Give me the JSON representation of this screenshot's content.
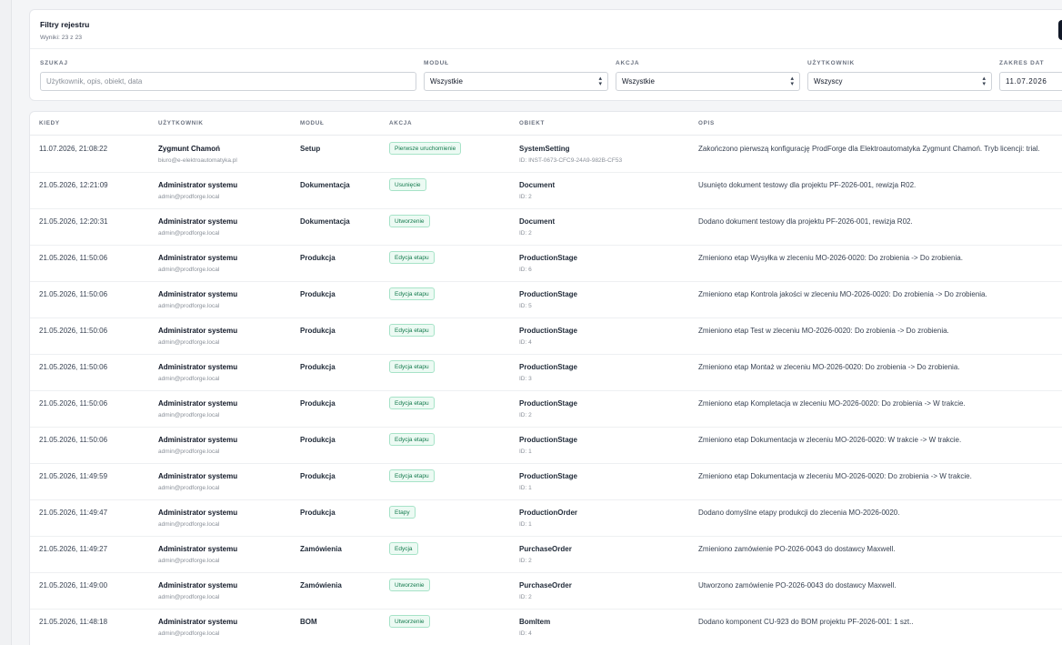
{
  "filters": {
    "title": "Filtry rejestru",
    "results": "Wyniki: 23 z 23",
    "search_label": "SZUKAJ",
    "search_placeholder": "Użytkownik, opis, obiekt, data",
    "module_label": "MODUŁ",
    "module_value": "Wszystkie",
    "action_label": "AKCJA",
    "action_value": "Wszystkie",
    "user_label": "UŻYTKOWNIK",
    "user_value": "Wszyscy",
    "date_label": "ZAKRES DAT",
    "date_value": "11.07.2026"
  },
  "table": {
    "headers": {
      "when": "KIEDY",
      "user": "UŻYTKOWNIK",
      "module": "MODUŁ",
      "action": "AKCJA",
      "object": "OBIEKT",
      "description": "OPIS"
    },
    "rows": [
      {
        "when": "11.07.2026, 21:08:22",
        "user": "Zygmunt Chamoń",
        "email": "biuro@e-elektroautomatyka.pl",
        "module": "Setup",
        "action": "Pierwsze uruchomienie",
        "object": "SystemSetting",
        "object_id": "ID: INST-0673-CFC9-24A9-982B-CF53",
        "description": "Zakończono pierwszą konfigurację ProdForge dla Elektroautomatyka Zygmunt Chamoń. Tryb licencji: trial."
      },
      {
        "when": "21.05.2026, 12:21:09",
        "user": "Administrator systemu",
        "email": "admin@prodforge.local",
        "module": "Dokumentacja",
        "action": "Usunięcie",
        "object": "Document",
        "object_id": "ID: 2",
        "description": "Usunięto dokument testowy dla projektu PF-2026-001, rewizja R02."
      },
      {
        "when": "21.05.2026, 12:20:31",
        "user": "Administrator systemu",
        "email": "admin@prodforge.local",
        "module": "Dokumentacja",
        "action": "Utworzenie",
        "object": "Document",
        "object_id": "ID: 2",
        "description": "Dodano dokument testowy dla projektu PF-2026-001, rewizja R02."
      },
      {
        "when": "21.05.2026, 11:50:06",
        "user": "Administrator systemu",
        "email": "admin@prodforge.local",
        "module": "Produkcja",
        "action": "Edycja etapu",
        "object": "ProductionStage",
        "object_id": "ID: 6",
        "description": "Zmieniono etap Wysyłka w zleceniu MO-2026-0020: Do zrobienia -> Do zrobienia."
      },
      {
        "when": "21.05.2026, 11:50:06",
        "user": "Administrator systemu",
        "email": "admin@prodforge.local",
        "module": "Produkcja",
        "action": "Edycja etapu",
        "object": "ProductionStage",
        "object_id": "ID: 5",
        "description": "Zmieniono etap Kontrola jakości w zleceniu MO-2026-0020: Do zrobienia -> Do zrobienia."
      },
      {
        "when": "21.05.2026, 11:50:06",
        "user": "Administrator systemu",
        "email": "admin@prodforge.local",
        "module": "Produkcja",
        "action": "Edycja etapu",
        "object": "ProductionStage",
        "object_id": "ID: 4",
        "description": "Zmieniono etap Test w zleceniu MO-2026-0020: Do zrobienia -> Do zrobienia."
      },
      {
        "when": "21.05.2026, 11:50:06",
        "user": "Administrator systemu",
        "email": "admin@prodforge.local",
        "module": "Produkcja",
        "action": "Edycja etapu",
        "object": "ProductionStage",
        "object_id": "ID: 3",
        "description": "Zmieniono etap Montaż w zleceniu MO-2026-0020: Do zrobienia -> Do zrobienia."
      },
      {
        "when": "21.05.2026, 11:50:06",
        "user": "Administrator systemu",
        "email": "admin@prodforge.local",
        "module": "Produkcja",
        "action": "Edycja etapu",
        "object": "ProductionStage",
        "object_id": "ID: 2",
        "description": "Zmieniono etap Kompletacja w zleceniu MO-2026-0020: Do zrobienia -> W trakcie."
      },
      {
        "when": "21.05.2026, 11:50:06",
        "user": "Administrator systemu",
        "email": "admin@prodforge.local",
        "module": "Produkcja",
        "action": "Edycja etapu",
        "object": "ProductionStage",
        "object_id": "ID: 1",
        "description": "Zmieniono etap Dokumentacja w zleceniu MO-2026-0020: W trakcie -> W trakcie."
      },
      {
        "when": "21.05.2026, 11:49:59",
        "user": "Administrator systemu",
        "email": "admin@prodforge.local",
        "module": "Produkcja",
        "action": "Edycja etapu",
        "object": "ProductionStage",
        "object_id": "ID: 1",
        "description": "Zmieniono etap Dokumentacja w zleceniu MO-2026-0020: Do zrobienia -> W trakcie."
      },
      {
        "when": "21.05.2026, 11:49:47",
        "user": "Administrator systemu",
        "email": "admin@prodforge.local",
        "module": "Produkcja",
        "action": "Etapy",
        "object": "ProductionOrder",
        "object_id": "ID: 1",
        "description": "Dodano domyślne etapy produkcji do zlecenia MO-2026-0020."
      },
      {
        "when": "21.05.2026, 11:49:27",
        "user": "Administrator systemu",
        "email": "admin@prodforge.local",
        "module": "Zamówienia",
        "action": "Edycja",
        "object": "PurchaseOrder",
        "object_id": "ID: 2",
        "description": "Zmieniono zamówienie PO-2026-0043 do dostawcy Maxwell."
      },
      {
        "when": "21.05.2026, 11:49:00",
        "user": "Administrator systemu",
        "email": "admin@prodforge.local",
        "module": "Zamówienia",
        "action": "Utworzenie",
        "object": "PurchaseOrder",
        "object_id": "ID: 2",
        "description": "Utworzono zamówienie PO-2026-0043 do dostawcy Maxwell."
      },
      {
        "when": "21.05.2026, 11:48:18",
        "user": "Administrator systemu",
        "email": "admin@prodforge.local",
        "module": "BOM",
        "action": "Utworzenie",
        "object": "BomItem",
        "object_id": "ID: 4",
        "description": "Dodano komponent CU-923 do BOM projektu PF-2026-001: 1 szt.."
      }
    ]
  }
}
